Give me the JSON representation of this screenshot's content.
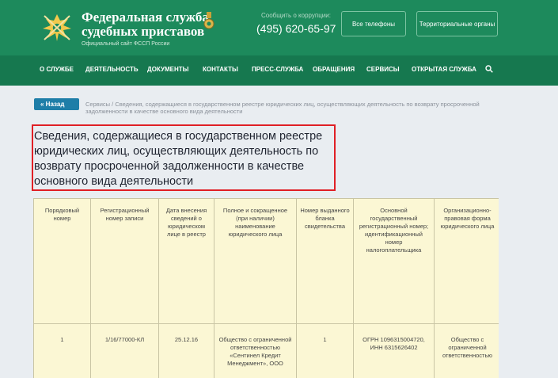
{
  "header": {
    "title_line1": "Федеральная служба",
    "title_line2": "судебных приставов",
    "subtitle": "Официальный сайт ФССП России",
    "report_label": "Сообщить о коррупции:",
    "phone": "(495) 620-65-97",
    "btn_phones": "Все телефоны",
    "btn_regions": "Территориальные органы",
    "brand_color": "#1d8a5c"
  },
  "nav": {
    "items": [
      "О СЛУЖБЕ",
      "ДЕЯТЕЛЬНОСТЬ",
      "ДОКУМЕНТЫ",
      "КОНТАКТЫ",
      "ПРЕСС-СЛУЖБА",
      "ОБРАЩЕНИЯ",
      "СЕРВИСЫ",
      "ОТКРЫТАЯ СЛУЖБА"
    ],
    "search_icon": "search-icon"
  },
  "back_label": "« Назад",
  "breadcrumb": {
    "root": "Сервисы",
    "separator": "/",
    "current": "Сведения, содержащиеся в государственном реестре юридических лиц, осуществляющих деятельность по возврату просроченной задолженности в качестве основного вида деятельности"
  },
  "page_title": "Сведения, содержащиеся в государственном реестре юридических лиц, осуществляющих деятельность по возврату просроченной задолженности в качестве основного вида деятельности",
  "table": {
    "headers": [
      "Порядковый номер",
      "Регистрационный номер записи",
      "Дата внесения сведений о юридическом лице в реестр",
      "Полное и сокращенное (при наличии) наименование юридического лица",
      "Номер выданного бланка свидетельства",
      "Основной государственный регистрационный номер; идентификационный номер налогоплательщика",
      "Организационно-правовая форма юридического лица"
    ],
    "rows": [
      [
        "1",
        "1/16/77000-КЛ",
        "25.12.16",
        "Общество с ограниченной ответственностью «Сентинел Кредит Менеджмент», ООО",
        "1",
        "ОГРН 1096315004720, ИНН 6315626402",
        "Общество с ограниченной ответственностью"
      ]
    ]
  }
}
